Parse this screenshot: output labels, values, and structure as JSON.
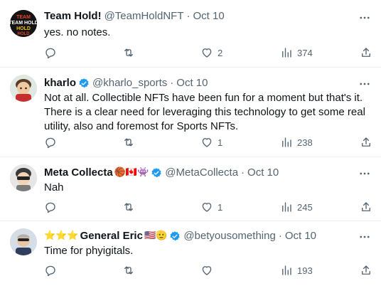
{
  "tweets": [
    {
      "name": "Team Hold!",
      "handle": "@TeamHoldNFT",
      "dot": "·",
      "time": "Oct 10",
      "text": "yes. no notes.",
      "avatar_text": "TEAM HOLD",
      "verified": false,
      "name_emojis": "",
      "name_prefix_emojis": "",
      "replies": "",
      "retweets": "",
      "likes": "2",
      "views": "374"
    },
    {
      "name": "kharlo",
      "handle": "@kharlo_sports",
      "dot": "·",
      "time": "Oct 10",
      "text": "Not at all. Collectible NFTs have been fun for a moment but that's it. There is a clear need for leveraging this technology to get some real utility, also and foremost for Sports NFTs.",
      "verified": true,
      "name_emojis": "",
      "name_prefix_emojis": "",
      "replies": "",
      "retweets": "",
      "likes": "1",
      "views": "238"
    },
    {
      "name": "Meta Collecta",
      "handle": "@MetaCollecta",
      "dot": "·",
      "time": "Oct 10",
      "text": "Nah",
      "verified": true,
      "name_emojis": "🏀🇨🇦👾",
      "name_prefix_emojis": "",
      "replies": "",
      "retweets": "",
      "likes": "1",
      "views": "245"
    },
    {
      "name": "General Eric",
      "handle": "@betyousomething",
      "dot": "·",
      "time": "Oct 10",
      "text": "Time for phyigitals.",
      "verified": true,
      "name_emojis": "🇺🇸🫡",
      "name_prefix_emojis": "⭐⭐⭐",
      "replies": "",
      "retweets": "",
      "likes": "",
      "views": "193"
    }
  ],
  "icons": {
    "reply": "reply-icon",
    "retweet": "retweet-icon",
    "like": "heart-icon",
    "views": "views-icon",
    "share": "share-icon",
    "more": "more-icon",
    "verified": "verified-badge-icon"
  },
  "colors": {
    "name": "#0f1419",
    "secondary": "#536471",
    "verified": "#1d9bf0",
    "divider": "#eff3f4"
  }
}
